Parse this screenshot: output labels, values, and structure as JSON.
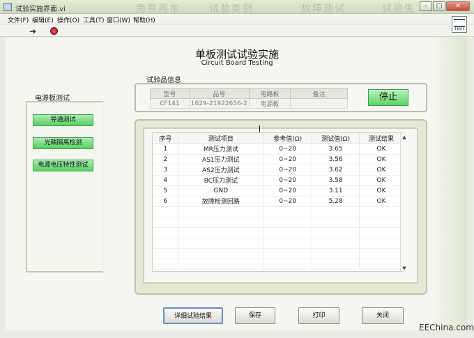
{
  "window": {
    "title": "试验实施界面.vi",
    "ghost_tabs": [
      "南京再东",
      "试验类别",
      "故障测试",
      "试验失"
    ],
    "minimize": "–",
    "maximize": "□",
    "close": "✕"
  },
  "menu": [
    "文件(F)",
    "编辑(E)",
    "操作(O)",
    "工具(T)",
    "窗口(W)",
    "帮助(H)"
  ],
  "toolbar": {
    "run_icon": "➔",
    "test_badge": "TEST"
  },
  "header": {
    "title": "单板测试试验实施",
    "subtitle": "Circuit Board Testing"
  },
  "sample_info": {
    "label": "试验品信息",
    "columns": [
      "型号",
      "品号",
      "电路板",
      "备注"
    ],
    "row": [
      "CF141",
      "1629-21922656-2",
      "电源板",
      ""
    ]
  },
  "stop_button": "停止",
  "power_test": {
    "label": "电源板测试",
    "buttons": [
      "导通测试",
      "光耦隔离检测",
      "电源电压特性测试"
    ]
  },
  "results": {
    "columns": [
      "序号",
      "测试项目",
      "参考值(Ω)",
      "测试值(Ω)",
      "测试结果"
    ],
    "rows": [
      [
        "1",
        "MR压力测试",
        "0~20",
        "3.65",
        "OK"
      ],
      [
        "2",
        "AS1压力测试",
        "0~20",
        "3.56",
        "OK"
      ],
      [
        "3",
        "AS2压力测试",
        "0~20",
        "3.62",
        "OK"
      ],
      [
        "4",
        "BC压力测试",
        "0~20",
        "3.58",
        "OK"
      ],
      [
        "5",
        "GND",
        "0~20",
        "3.11",
        "OK"
      ],
      [
        "6",
        "故障检测回路",
        "0~20",
        "5.28",
        "OK"
      ]
    ]
  },
  "footer_buttons": [
    "详细试验结果",
    "保存",
    "打印",
    "关闭"
  ],
  "watermark": "EEChina.com",
  "colors": {
    "green_button": "#5cd466",
    "panel_bg": "#f4f6ef",
    "frame_bg": "#e4e9d4"
  }
}
